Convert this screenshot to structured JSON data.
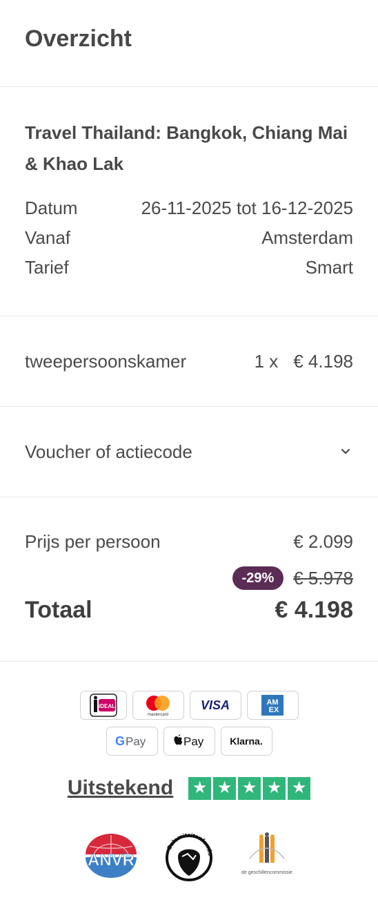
{
  "header": {
    "title": "Overzicht"
  },
  "trip": {
    "title": "Travel Thailand: Bangkok, Chiang Mai & Khao Lak",
    "rows": [
      {
        "label": "Datum",
        "value": "26-11-2025 tot 16-12-2025"
      },
      {
        "label": "Vanaf",
        "value": "Amsterdam"
      },
      {
        "label": "Tarief",
        "value": "Smart"
      }
    ]
  },
  "room": {
    "name": "tweepersoonskamer",
    "qty": "1 x",
    "price": "€ 4.198"
  },
  "voucher": {
    "label": "Voucher of actiecode",
    "icon": "chevron-down-icon"
  },
  "pricing": {
    "per_person_label": "Prijs per persoon",
    "per_person_value": "€ 2.099",
    "discount_badge": "-29%",
    "old_price": "€ 5.978",
    "total_label": "Totaal",
    "total_value": "€ 4.198"
  },
  "payments": {
    "ideal": "iDEAL",
    "mastercard": "mastercard",
    "visa": "VISA",
    "amex_top": "AM",
    "amex_bottom": "EX",
    "gpay": "Pay",
    "applepay": "Pay",
    "klarna": "Klarna."
  },
  "trust": {
    "label": "Uitstekend",
    "stars": 5,
    "color": "#2fb67a"
  },
  "logos": {
    "anvr": "ANVR",
    "calamiteitenfonds": "Calamiteitenfonds",
    "geschillencommissie": "de geschillencommissie"
  },
  "colors": {
    "badge": "#5b2d56",
    "text": "#4a4a4a"
  }
}
